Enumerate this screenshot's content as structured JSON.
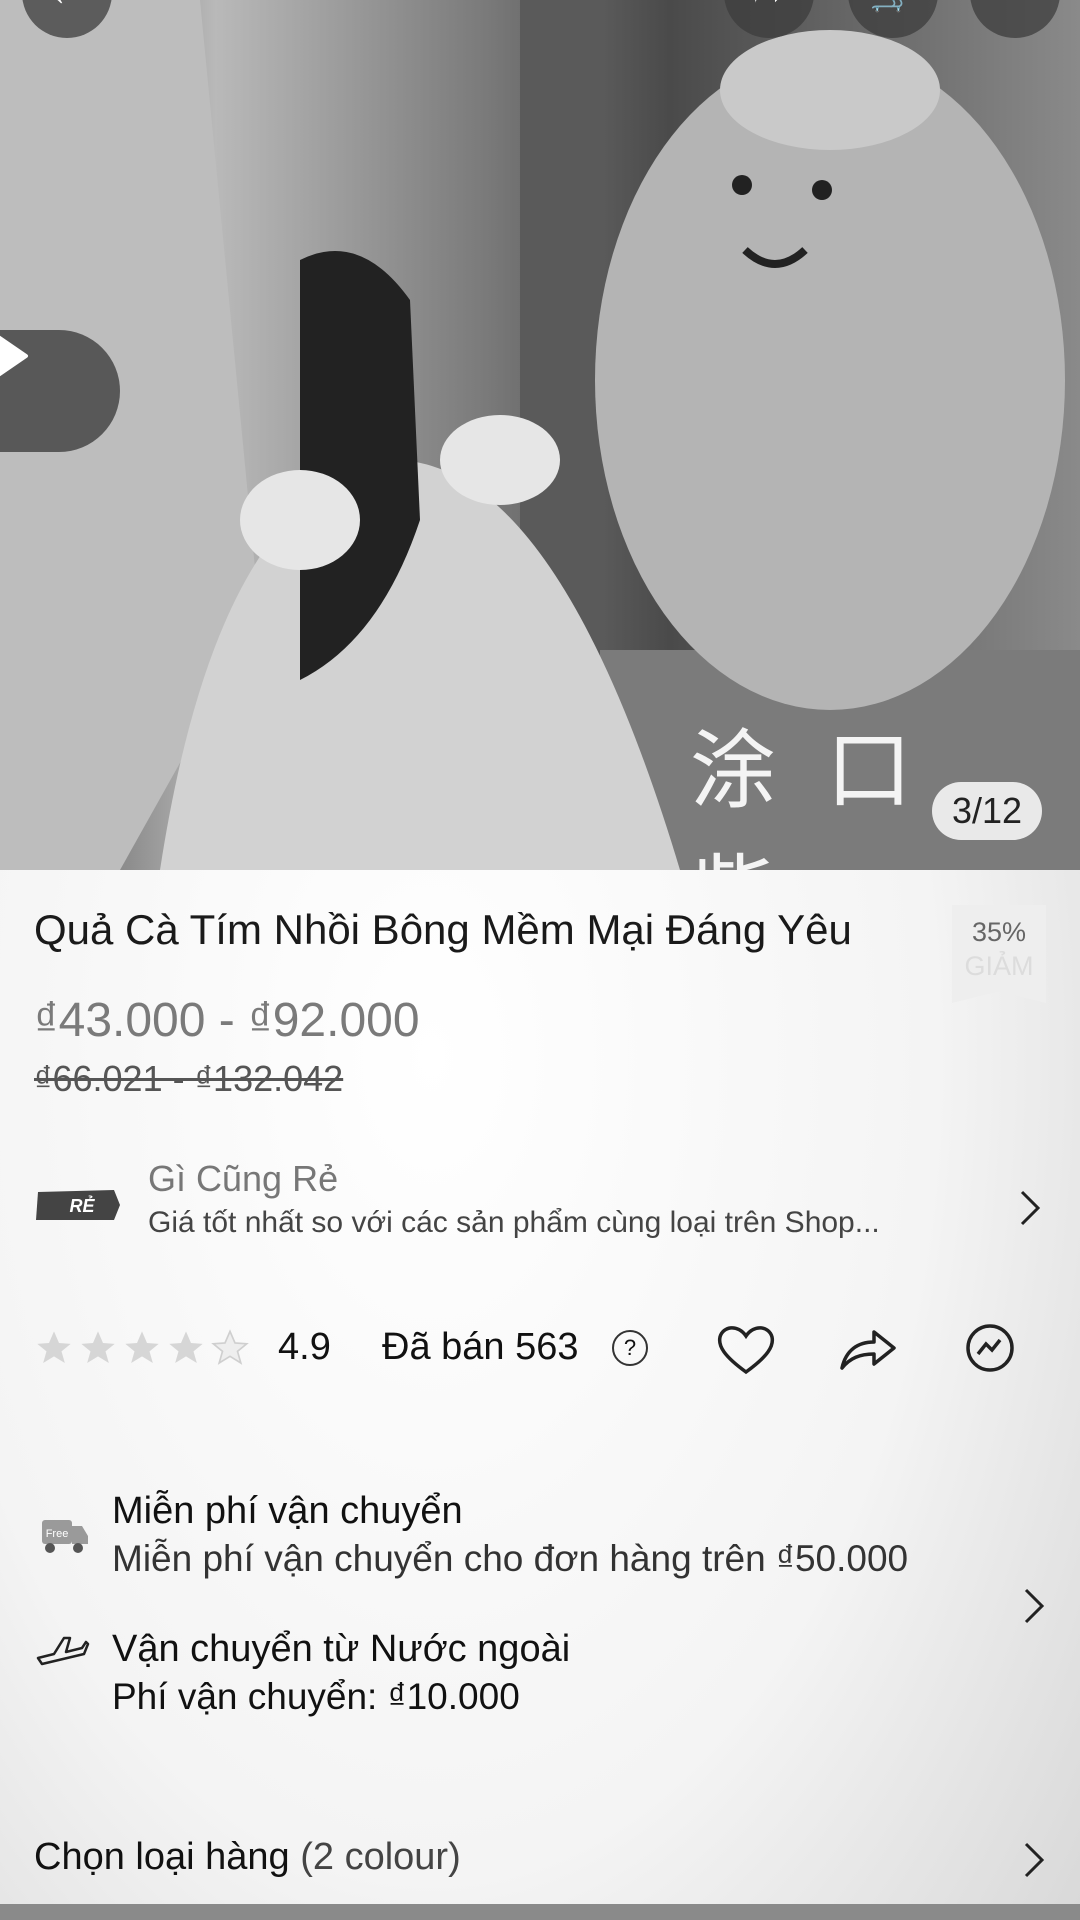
{
  "gallery": {
    "counter": "3/12",
    "watermark": "涂口紫"
  },
  "product": {
    "title": "Quả Cà Tím Nhồi Bông Mềm Mại Đáng Yêu",
    "discount_percent": "35%",
    "discount_label": "GIẢM",
    "price_range": "₫43.000 - ₫92.000",
    "original_price_range": "₫66.021 - ₫132.042"
  },
  "promo": {
    "logo_text": "RẺ",
    "title": "Gì Cũng Rẻ",
    "description": "Giá tốt nhất so với các sản phẩm cùng loại trên Shop..."
  },
  "stats": {
    "rating": "4.9",
    "stars_filled": 4.9,
    "sold_label": "Đã bán 563",
    "help_icon": "question-circle-icon"
  },
  "shipping": {
    "free": {
      "icon_label": "Free",
      "title": "Miễn phí vận chuyển",
      "subtitle": "Miễn phí vận chuyển cho đơn hàng trên ₫50.000"
    },
    "international": {
      "title": "Vận chuyển từ Nước ngoài",
      "subtitle": "Phí vận chuyển: ₫10.000"
    }
  },
  "variant": {
    "label": "Chọn loại hàng",
    "count": "(2 colour)"
  },
  "colors": {
    "text": "#111111",
    "price": "#7a7a7a",
    "muted": "#444444"
  }
}
